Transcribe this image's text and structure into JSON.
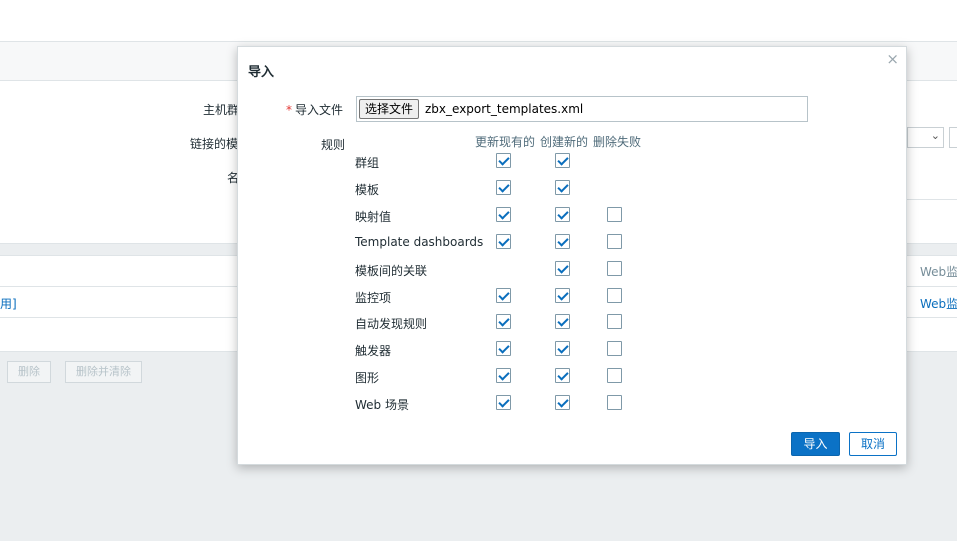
{
  "background": {
    "filter_labels": [
      "主机群",
      "链接的模",
      "名"
    ],
    "table_links": [
      "Web监",
      "Web监"
    ],
    "row_fragment": "用]",
    "buttons": [
      "删除",
      "删除并清除"
    ]
  },
  "dialog": {
    "title": "导入",
    "close_glyph": "×",
    "file_label": "导入文件",
    "required_mark": "*",
    "file_button": "选择文件",
    "file_name": "zbx_export_templates.xml",
    "rules_label": "规则",
    "columns": [
      "更新现有的",
      "创建新的",
      "删除失败"
    ],
    "rules": [
      {
        "label": "群组",
        "update": true,
        "create": true,
        "delete": null
      },
      {
        "label": "模板",
        "update": true,
        "create": true,
        "delete": null
      },
      {
        "label": "映射值",
        "update": true,
        "create": true,
        "delete": false
      },
      {
        "label": "Template dashboards",
        "update": true,
        "create": true,
        "delete": false
      },
      {
        "label": "模板间的关联",
        "update": null,
        "create": true,
        "delete": false
      },
      {
        "label": "监控项",
        "update": true,
        "create": true,
        "delete": false
      },
      {
        "label": "自动发现规则",
        "update": true,
        "create": true,
        "delete": false
      },
      {
        "label": "触发器",
        "update": true,
        "create": true,
        "delete": false
      },
      {
        "label": "图形",
        "update": true,
        "create": true,
        "delete": false
      },
      {
        "label": "Web 场景",
        "update": true,
        "create": true,
        "delete": false
      }
    ],
    "import_button": "导入",
    "cancel_button": "取消"
  },
  "colors": {
    "accent": "#0b72c6",
    "required": "#e33734"
  }
}
